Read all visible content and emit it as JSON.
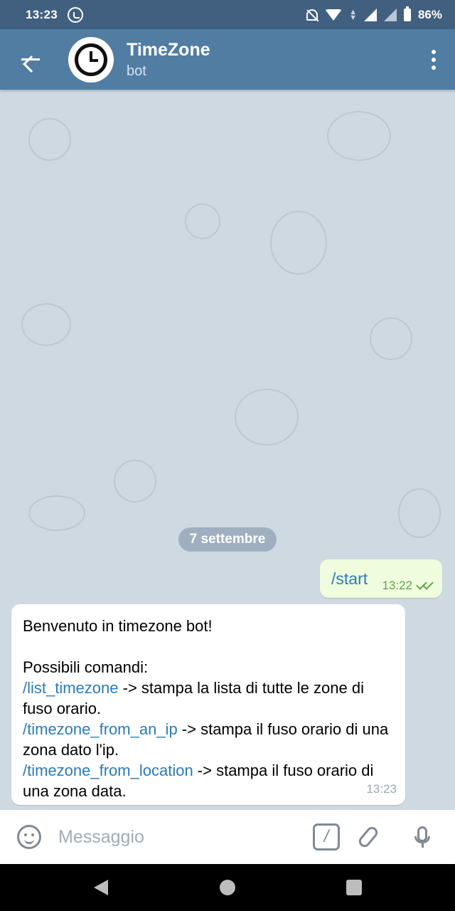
{
  "status_bar": {
    "time": "13:23",
    "battery": "86%"
  },
  "header": {
    "title": "TimeZone",
    "subtitle": "bot"
  },
  "chat": {
    "date_chip": "7 settembre",
    "outgoing": {
      "text": "/start",
      "time": "13:22"
    },
    "incoming": {
      "line1": "Benvenuto in timezone bot!",
      "line2": "Possibili comandi:",
      "cmd1": "/list_timezone",
      "desc1": " -> stampa la lista di tutte le zone di fuso orario.",
      "cmd2": "/timezone_from_an_ip",
      "desc2": " -> stampa il fuso orario di una zona dato l'ip.",
      "cmd3": "/timezone_from_location",
      "desc3": " -> stampa il fuso orario di una zona data.",
      "time": "13:23"
    }
  },
  "input": {
    "placeholder": "Messaggio",
    "command_symbol": "/"
  },
  "colors": {
    "header": "#517da2",
    "status_bar": "#41607f",
    "chat_bg": "#cfd9e2",
    "outgoing_bubble": "#effdde",
    "link": "#2b7bb9"
  }
}
